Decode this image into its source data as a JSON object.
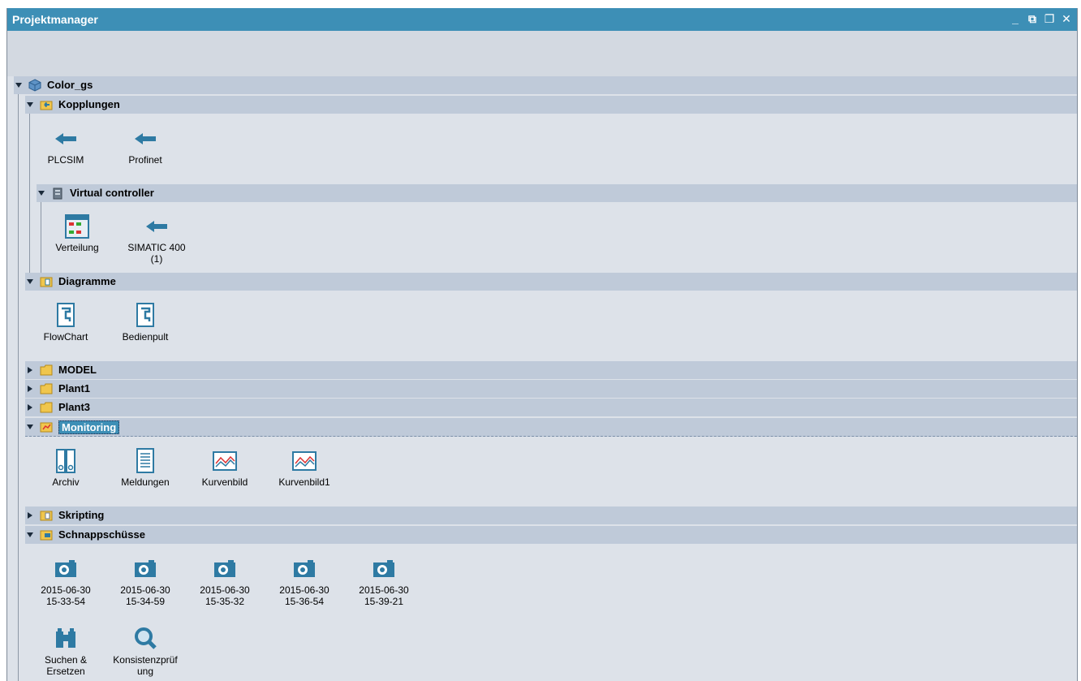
{
  "window": {
    "title": "Projektmanager"
  },
  "controls": {
    "minimize": "_",
    "popout": "⧉",
    "restore": "❐",
    "close": "✕"
  },
  "colors": {
    "titlebar": "#3d8fb6",
    "row": "#bfcad9",
    "panel": "#dde2e9",
    "link_arrow": "#2e7aa3"
  },
  "tree": {
    "root": {
      "label": "Color_gs",
      "icon": "cube-icon",
      "expanded": true
    },
    "kopplungen": {
      "label": "Kopplungen",
      "expanded": true,
      "items": [
        {
          "label": "PLCSIM",
          "icon": "arrow-left-icon"
        },
        {
          "label": "Profinet",
          "icon": "arrow-left-icon"
        }
      ],
      "virtual_controller": {
        "label": "Virtual controller",
        "expanded": true,
        "items": [
          {
            "label": "Verteilung",
            "icon": "distribution-icon"
          },
          {
            "label": "SIMATIC 400\n(1)",
            "icon": "arrow-left-icon"
          }
        ]
      }
    },
    "diagramme": {
      "label": "Diagramme",
      "expanded": true,
      "items": [
        {
          "label": "FlowChart",
          "icon": "flowchart-icon"
        },
        {
          "label": "Bedienpult",
          "icon": "flowchart-icon"
        }
      ]
    },
    "model": {
      "label": "MODEL",
      "expanded": false
    },
    "plant1": {
      "label": "Plant1",
      "expanded": false
    },
    "plant3": {
      "label": "Plant3",
      "expanded": false
    },
    "monitoring": {
      "label": "Monitoring",
      "expanded": true,
      "selected": true,
      "items": [
        {
          "label": "Archiv",
          "icon": "archive-icon"
        },
        {
          "label": "Meldungen",
          "icon": "messages-icon"
        },
        {
          "label": "Kurvenbild",
          "icon": "trend-chart-icon"
        },
        {
          "label": "Kurvenbild1",
          "icon": "trend-chart-icon"
        }
      ]
    },
    "skripting": {
      "label": "Skripting",
      "expanded": false
    },
    "schnappschuesse": {
      "label": "Schnappschüsse",
      "expanded": true,
      "items": [
        {
          "label": "2015-06-30\n15-33-54",
          "icon": "camera-icon"
        },
        {
          "label": "2015-06-30\n15-34-59",
          "icon": "camera-icon"
        },
        {
          "label": "2015-06-30\n15-35-32",
          "icon": "camera-icon"
        },
        {
          "label": "2015-06-30\n15-36-54",
          "icon": "camera-icon"
        },
        {
          "label": "2015-06-30\n15-39-21",
          "icon": "camera-icon"
        }
      ]
    },
    "tools": [
      {
        "label": "Suchen &\nErsetzen",
        "icon": "binoculars-icon"
      },
      {
        "label": "Konsistenzprüf\nung",
        "icon": "magnifier-icon"
      }
    ]
  }
}
